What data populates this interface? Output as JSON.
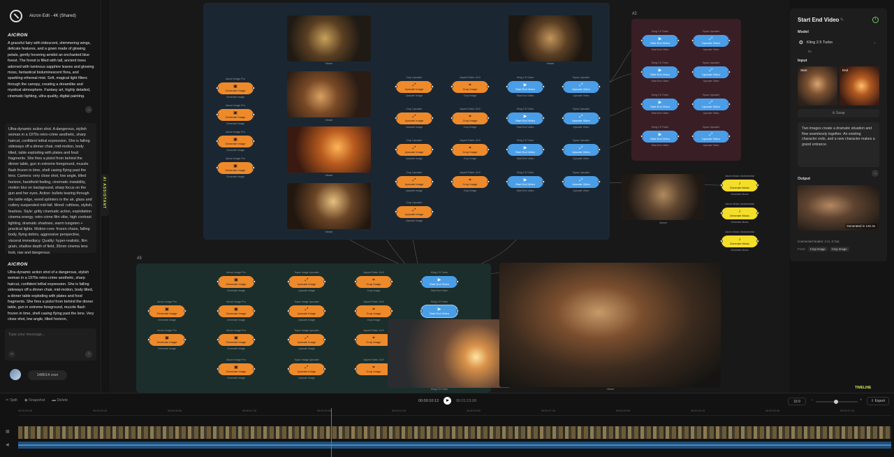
{
  "app": {
    "title": "Aicron Edit - 4K (Shared)",
    "brand": "AICRON"
  },
  "chat": {
    "messages": [
      "A graceful fairy with iridescent, shimmering wings, delicate features, and a gown made of glowing petals, gently hovering amidst an enchanted blue forest. The forest is filled with tall, ancient trees adorned with luminous sapphire leaves and glowing moss, fantastical bioluminescent flora, and sparkling ethereal mist. Soft, magical light filters through the canopy, creating a dreamlike and mystical atmosphere. Fantasy art, highly detailed, cinematic lighting, ultra quality, digital painting.",
      "Ultra-dynamic action shot. A dangerous, stylish woman in a 1970s retro-crime aesthetic, sharp haircut, confident lethal expression. She is falling sideways off a dinner chair, mid-motion, body tilted, table exploding with plates and food fragments. She fires a pistol from behind the dinner table, gun in extreme foreground, muzzle flash frozen in time, shell casing flying past the lens. Camera: very close shot, low angle, tilted horizon, handheld feeling, cinematic instability, motion blur on background, sharp focus on the gun and her eyes. Action: bullets tearing through the table edge, wood splinters in the air, glass and cutlery suspended mid-fall. Mood: ruthless, stylish, fearless. Style: gritty cinematic action, exploitation cinema energy, retro crime film vibe, high contrast lighting, dramatic shadows, warm tungsten + practical lights. Motion-core: frozen chaos, falling body, flying debris, aggressive perspective, visceral immediacy. Quality: hyper-realistic, film grain, shallow depth of field, 35mm cinema lens look, raw and dangerous.",
      "Ultra-dynamic action shot of a dangerous, stylish woman in a 1970s retro-crime aesthetic, sharp haircut, confident lethal expression. She is falling sideways off a dinner chair, mid-motion, body tilted, a dinner table exploding with plates and food fragments. She fires a pistol from behind the dinner table, gun in extreme foreground, muzzle flash frozen in time, shell casing flying past the lens. Very close shot, low angle, tilted horizon,"
    ],
    "input_placeholder": "Type your message...",
    "credits": "148614 cron",
    "assistant_tab": "AI ASSISTANT"
  },
  "canvas": {
    "group2_label": "#2",
    "group3_label": "#3",
    "timeline_tag": "TIMELINE",
    "labels": {
      "aicron_image_pro": "Aicron Image Pro",
      "generate_image": "Generate Image",
      "crop_upscaler": "Crop Upscaler",
      "upscale_image": "Upscale Image",
      "aspect_ratio": "Aspect Ratio: 16:9",
      "crop_image": "Crop Image",
      "kling": "Kling 2.5 Turbo",
      "start_end_video": "Start End Video",
      "topaz_upscaler": "Topaz Upscaler",
      "upscale_video": "Upscale Video",
      "topaz_image_upscaler": "Topaz Image Upscaler",
      "aicron_music": "Aicron Music Instrumental",
      "generate_music": "Generate Music",
      "viewer": "Viewer"
    }
  },
  "panel": {
    "title": "Start End Video",
    "model_label": "Model",
    "model_value": "Kling 2.5 Turbo",
    "duration": "5s",
    "input_label": "Input",
    "start_label": "Start",
    "end_label": "End",
    "swap_label": "Swap",
    "prompt": "Two images create a dramatic situation and flow seamlessly together. An existing character exits, and a new character makes a grand entrance.",
    "output_label": "Output",
    "generated": "Generated in 132.3s",
    "connected": "Connected Nodes: 2 In, 0 Out",
    "from_label": "From:",
    "from_chips": [
      "Crop Image",
      "Crop Image"
    ]
  },
  "timeline": {
    "tools": [
      "Split",
      "Snapshot",
      "Delete"
    ],
    "current_time": "00:00:10:13",
    "total_time": "00:01:23:08",
    "ratio": "16:9",
    "export_label": "Export",
    "ticks": [
      "00:00:00:00",
      "00:00:02:15",
      "00:00:05:00",
      "00:00:07:15",
      "00:00:10:00",
      "00:00:12:15",
      "00:00:15:00",
      "00:00:17:15",
      "00:00:20:00",
      "00:00:22:15",
      "00:00:25:00",
      "00:00:27:15"
    ]
  }
}
